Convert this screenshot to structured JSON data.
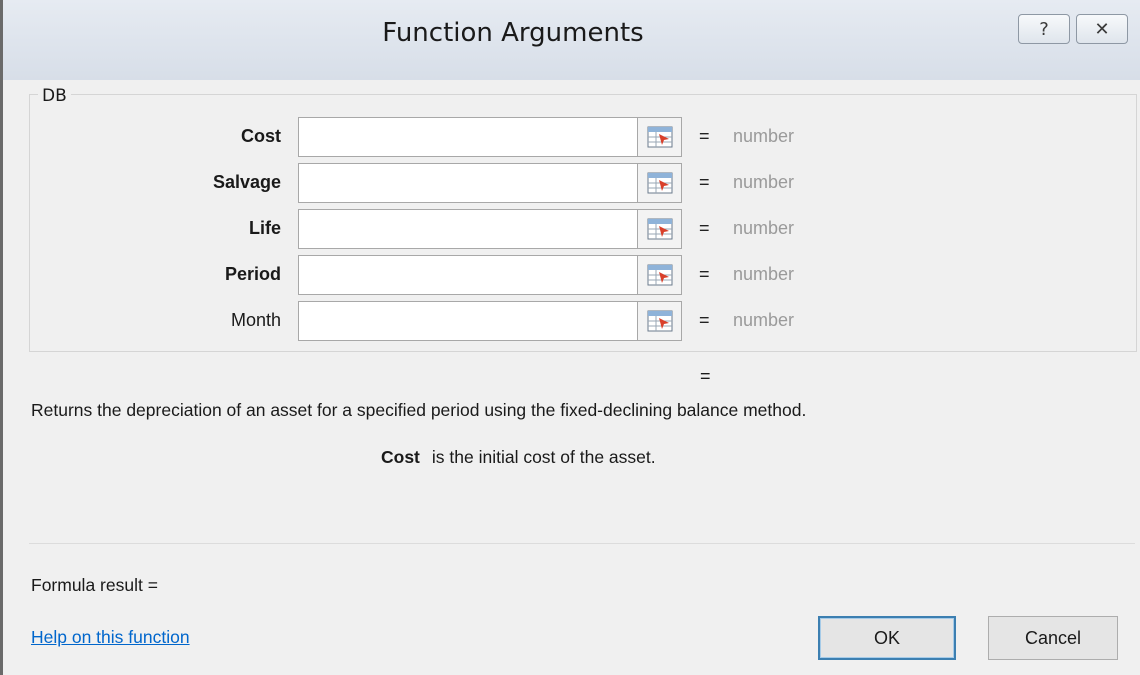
{
  "dialog": {
    "title": "Function Arguments",
    "help_glyph": "?",
    "close_glyph": "✕"
  },
  "function": {
    "name": "DB",
    "args": [
      {
        "label": "Cost",
        "bold": true,
        "value": "",
        "equals": "=",
        "hint": "number"
      },
      {
        "label": "Salvage",
        "bold": true,
        "value": "",
        "equals": "=",
        "hint": "number"
      },
      {
        "label": "Life",
        "bold": true,
        "value": "",
        "equals": "=",
        "hint": "number"
      },
      {
        "label": "Period",
        "bold": true,
        "value": "",
        "equals": "=",
        "hint": "number"
      },
      {
        "label": "Month",
        "bold": false,
        "value": "",
        "equals": "=",
        "hint": "number"
      }
    ],
    "result_equals": "=",
    "description": "Returns the depreciation of an asset for a specified period using the fixed-declining balance method.",
    "current_arg_name": "Cost",
    "current_arg_description": "is the initial cost of the asset."
  },
  "footer": {
    "formula_result": "Formula result =",
    "help_link": "Help on this function",
    "ok_label": "OK",
    "cancel_label": "Cancel"
  },
  "colors": {
    "hint": "#9a9a9a",
    "link": "#0066cc",
    "default_button_border": "#3c7fb1"
  }
}
